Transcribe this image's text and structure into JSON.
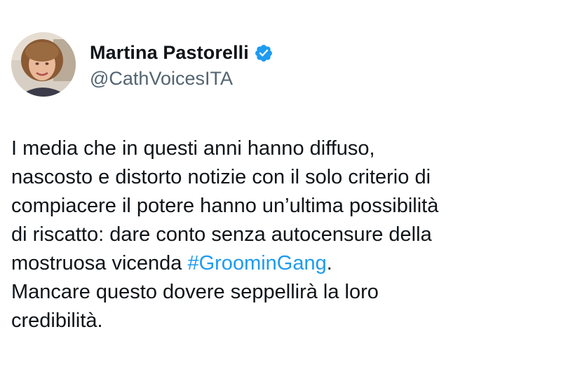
{
  "author": {
    "name": "Martina Pastorelli",
    "handle": "@CathVoicesITA",
    "verified": true
  },
  "tweet": {
    "line1": "I media che in questi anni hanno diffuso,",
    "line2": "nascosto e distorto notizie con il solo criterio di",
    "line3": "compiacere il potere hanno un’ultima possibilità",
    "line4": "di riscatto: dare conto senza autocensure della",
    "line5_prefix": "mostruosa vicenda ",
    "hashtag": "#GroominGang",
    "line5_suffix": ".",
    "line6": "Mancare questo dovere seppellirà la loro",
    "line7": "credibilità."
  },
  "icons": {
    "verified": "verified-badge-icon"
  },
  "colors": {
    "verified_badge": "#1d9bf0",
    "hashtag": "#1d9bf0",
    "handle": "#536471",
    "text": "#0f1419"
  }
}
